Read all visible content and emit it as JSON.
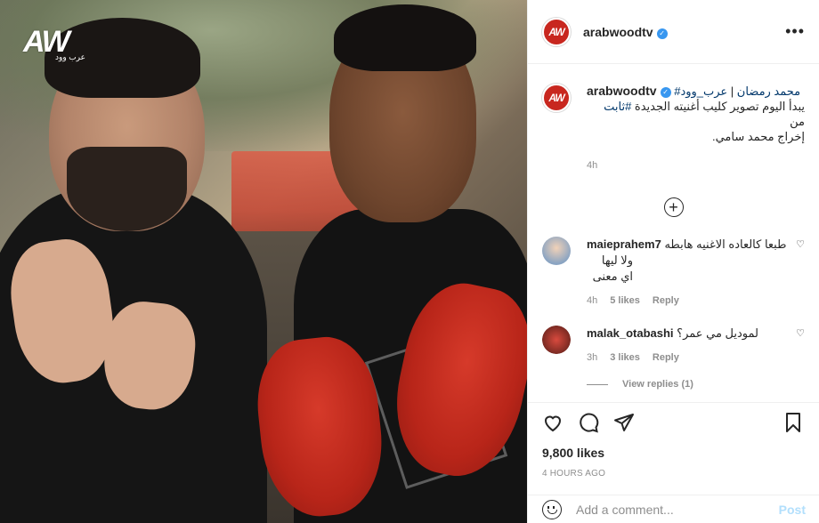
{
  "media": {
    "watermark": "AW",
    "watermark_sub": "عرب وود"
  },
  "header": {
    "avatar_text": "AW",
    "username": "arabwoodtv",
    "more_icon": "more-horizontal-icon"
  },
  "caption": {
    "avatar_text": "AW",
    "username": "arabwoodtv",
    "hashtag1": "#محمد رمضان",
    "separator": " | ",
    "hashtag_brand": "عرب_وود",
    "line2_prefix": "يبدأ اليوم تصوير كليب أغنيته الجديدة ",
    "hashtag2": "#ثابت",
    "line2_suffix": " من",
    "line3": "إخراج محمد سامي.",
    "time": "4h"
  },
  "load_more_icon": "plus-circle-icon",
  "comments": [
    {
      "username": "maieprahem7",
      "text_line1": "طبعا كالعاده الاغنيه هابطه",
      "text_line2": "ولا ليها اي معنى",
      "time": "4h",
      "likes": "5 likes",
      "reply": "Reply"
    },
    {
      "username": "malak_otabashi",
      "text_line1": "لموديل مي عمر؟",
      "time": "3h",
      "likes": "3 likes",
      "reply": "Reply"
    }
  ],
  "view_replies": "View replies (1)",
  "actions": {
    "like_icon": "heart-icon",
    "comment_icon": "comment-icon",
    "share_icon": "share-icon",
    "save_icon": "bookmark-icon"
  },
  "likes": "9,800 likes",
  "ago": "4 HOURS AGO",
  "add_comment": {
    "placeholder": "Add a comment...",
    "post_label": "Post"
  }
}
